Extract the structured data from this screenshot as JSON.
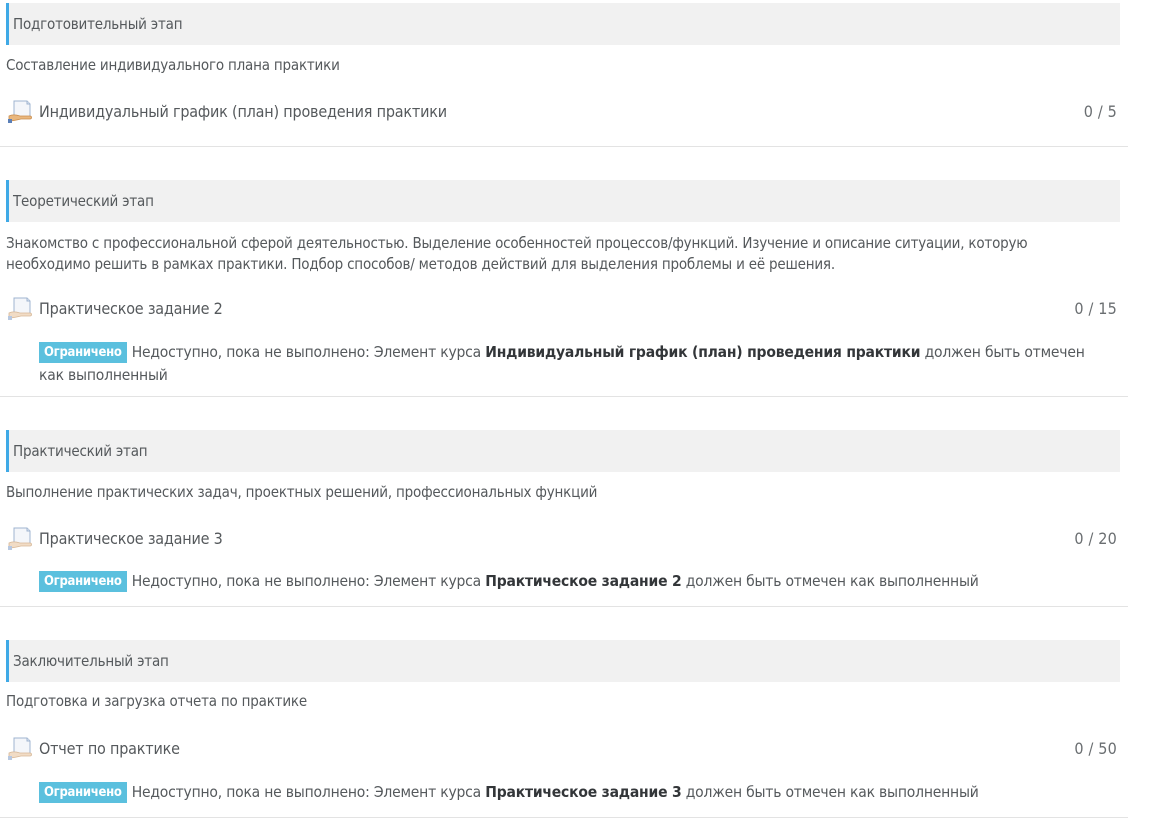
{
  "sections": [
    {
      "title": "Подготовительный этап",
      "summary": "Составление индивидуального плана практики",
      "activity": {
        "name": "Индивидуальный график (план) проведения практики",
        "score": "0 / 5",
        "icon": "assignment-icon"
      }
    },
    {
      "title": "Теоретический этап",
      "summary": "Знакомство с профессиональной сферой деятельностью. Выделение особенностей процессов/функций. Изучение и описание ситуации, которую необходимо решить в рамках практики. Подбор способов/ методов действий для выделения проблемы и её решения.",
      "activity": {
        "name": "Практическое задание 2",
        "score": "0 / 15",
        "icon": "assignment-icon"
      },
      "restriction": {
        "badge": "Ограничено",
        "prefix": "Недоступно, пока не выполнено: Элемент курса",
        "item": "Индивидуальный график (план) проведения практики",
        "suffix": "должен быть отмечен как выполненный"
      }
    },
    {
      "title": "Практический этап",
      "summary": "Выполнение практических задач, проектных решений, профессиональных функций",
      "activity": {
        "name": "Практическое задание 3",
        "score": "0 / 20",
        "icon": "assignment-icon"
      },
      "restriction": {
        "badge": "Ограничено",
        "prefix": "Недоступно, пока не выполнено: Элемент курса",
        "item": "Практическое задание 2",
        "suffix": "должен быть отмечен как выполненный"
      }
    },
    {
      "title": "Заключительный этап",
      "summary": "Подготовка и загрузка отчета по практике",
      "activity": {
        "name": "Отчет по практике",
        "score": "0 / 50",
        "icon": "assignment-icon"
      },
      "restriction": {
        "badge": "Ограничено",
        "prefix": "Недоступно, пока не выполнено: Элемент курса",
        "item": "Практическое задание 3",
        "suffix": "должен быть отмечен как выполненный"
      }
    }
  ],
  "colors": {
    "accent": "#3fa9e6",
    "badge": "#5bc0de",
    "header_bg": "#f1f1f1"
  }
}
